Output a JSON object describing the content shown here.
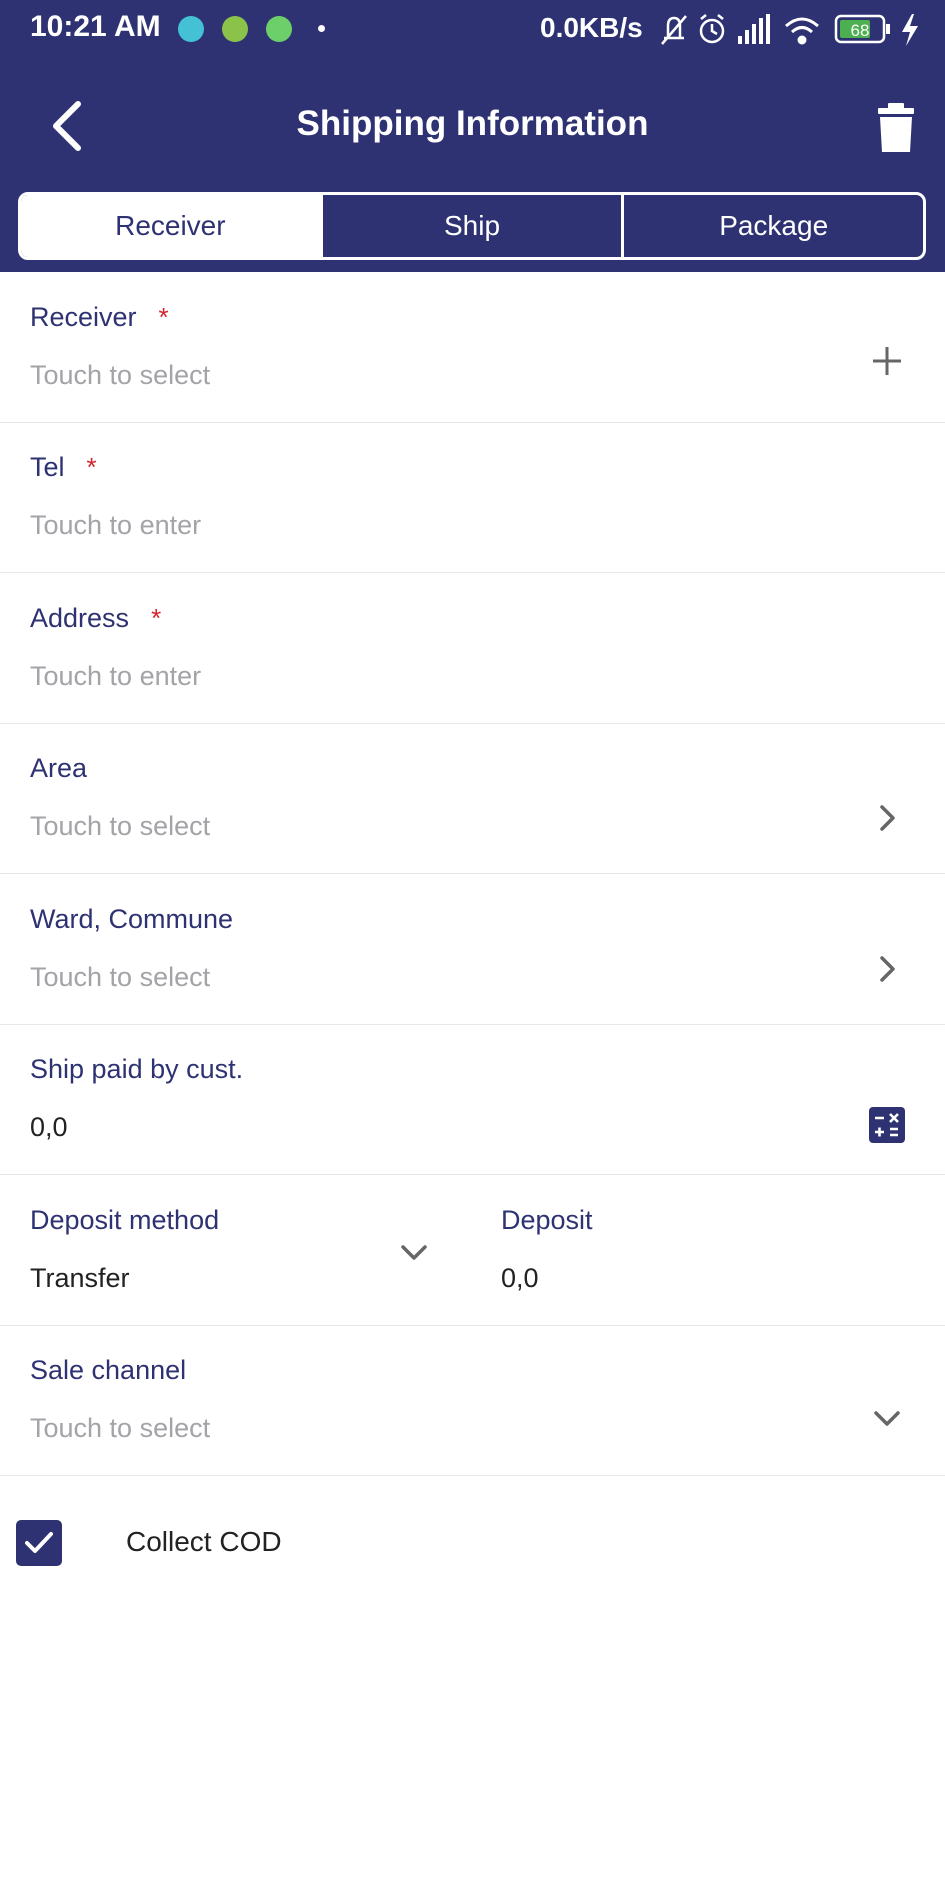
{
  "status_bar": {
    "time": "10:21 AM",
    "net_speed": "0.0KB/s",
    "battery": "68",
    "icons": [
      "app-notification-icon",
      "shield-app-icon",
      "robot-app-icon",
      "mute-icon",
      "alarm-icon",
      "signal-icon",
      "wifi-icon",
      "battery-icon",
      "charging-icon"
    ]
  },
  "header": {
    "title": "Shipping Information",
    "back_icon": "back-arrow-icon",
    "delete_icon": "trash-icon",
    "background": "#2e3272"
  },
  "tabs": [
    {
      "label": "Receiver",
      "active": true
    },
    {
      "label": "Ship",
      "active": false
    },
    {
      "label": "Package",
      "active": false
    }
  ],
  "form": {
    "receiver": {
      "label": "Receiver",
      "required_mark": "*",
      "placeholder": "Touch to select",
      "action_icon": "plus-icon"
    },
    "tel": {
      "label": "Tel",
      "required_mark": "*",
      "placeholder": "Touch to enter"
    },
    "address": {
      "label": "Address",
      "required_mark": "*",
      "placeholder": "Touch to enter"
    },
    "area": {
      "label": "Area",
      "placeholder": "Touch to select",
      "action_icon": "chevron-right-icon"
    },
    "ward": {
      "label": "Ward, Commune",
      "placeholder": "Touch to select",
      "action_icon": "chevron-right-icon"
    },
    "ship_paid": {
      "label": "Ship paid by cust.",
      "value": "0,0",
      "action_icon": "calculator-icon"
    },
    "deposit_method": {
      "label": "Deposit method",
      "value": "Transfer",
      "action_icon": "chevron-down-icon"
    },
    "deposit": {
      "label": "Deposit",
      "value": "0,0"
    },
    "sale_channel": {
      "label": "Sale channel",
      "placeholder": "Touch to select",
      "action_icon": "chevron-down-icon"
    }
  },
  "cod": {
    "label": "Collect COD",
    "checked": true
  },
  "colors": {
    "accent": "#2e3272",
    "required": "#d0262c",
    "placeholder": "#a3a3a8"
  }
}
